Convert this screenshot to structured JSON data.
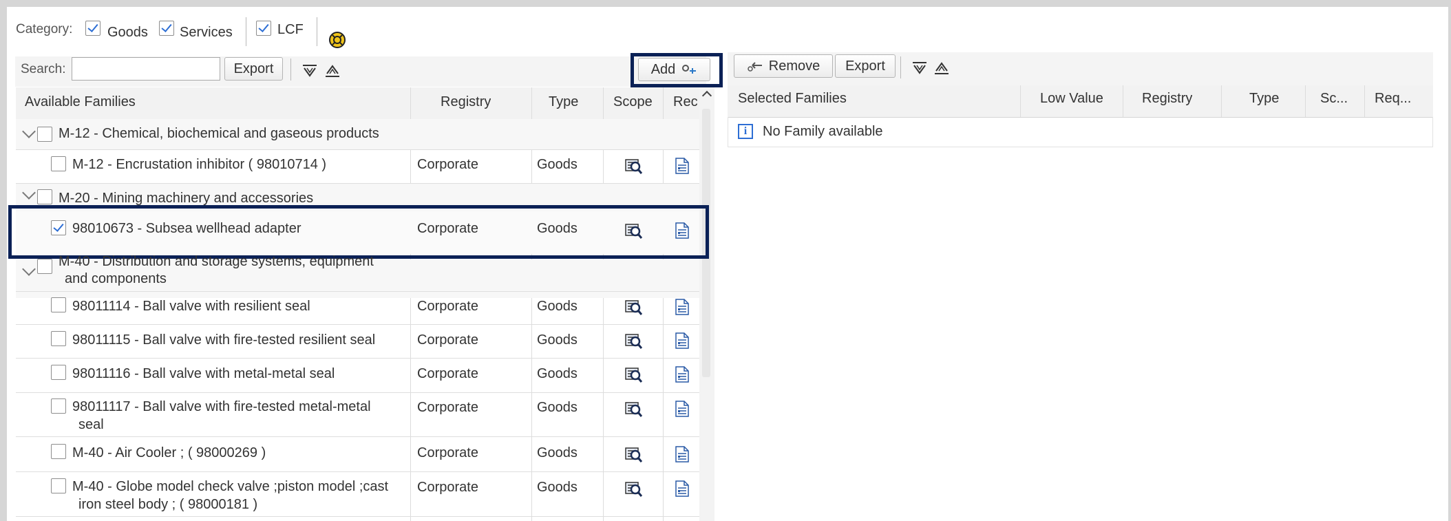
{
  "category": {
    "label": "Category:",
    "options": [
      {
        "label": "Goods",
        "checked": true
      },
      {
        "label": "Services",
        "checked": true
      },
      {
        "label": "LCF",
        "checked": true
      }
    ],
    "help_icon": "help-circle-icon"
  },
  "left": {
    "search_label": "Search:",
    "search_value": "",
    "export_label": "Export",
    "add_label": "Add",
    "expand_icon": "expand-all-icon",
    "collapse_icon": "collapse-all-icon",
    "columns": [
      "Available Families",
      "Registry",
      "Type",
      "Scope",
      "Rec"
    ],
    "groups": [
      {
        "label": "M-12 - Chemical, biochemical and gaseous products"
      },
      {
        "label": "M-20 - Mining machinery and accessories"
      },
      {
        "label_line1": "M-40 - Distribution and storage systems, equipment",
        "label_line2": "and components"
      }
    ],
    "rows": [
      {
        "name": "M-12 - Encrustation inhibitor ( 98010714 )",
        "registry": "Corporate",
        "type": "Goods",
        "checked": false
      },
      {
        "name": "98010673 - Subsea wellhead adapter",
        "registry": "Corporate",
        "type": "Goods",
        "checked": true
      },
      {
        "name": "98011114 - Ball valve with resilient seal",
        "registry": "Corporate",
        "type": "Goods",
        "checked": false
      },
      {
        "name": "98011115 - Ball valve with fire-tested resilient seal",
        "registry": "Corporate",
        "type": "Goods",
        "checked": false
      },
      {
        "name": "98011116 - Ball valve with metal-metal seal",
        "registry": "Corporate",
        "type": "Goods",
        "checked": false
      },
      {
        "name_line1": "98011117 - Ball valve with fire-tested metal-metal",
        "name_line2": "seal",
        "registry": "Corporate",
        "type": "Goods",
        "checked": false
      },
      {
        "name": "M-40 - Air Cooler ; ( 98000269 )",
        "registry": "Corporate",
        "type": "Goods",
        "checked": false
      },
      {
        "name_line1": "M-40 - Globe model check valve ;piston model ;cast",
        "name_line2": "iron steel body ; ( 98000181 )",
        "registry": "Corporate",
        "type": "Goods",
        "checked": false
      }
    ]
  },
  "right": {
    "remove_label": "Remove",
    "export_label": "Export",
    "columns": [
      "Selected Families",
      "Low Value",
      "Registry",
      "Type",
      "Sc...",
      "Req..."
    ],
    "empty_message": "No Family available"
  }
}
